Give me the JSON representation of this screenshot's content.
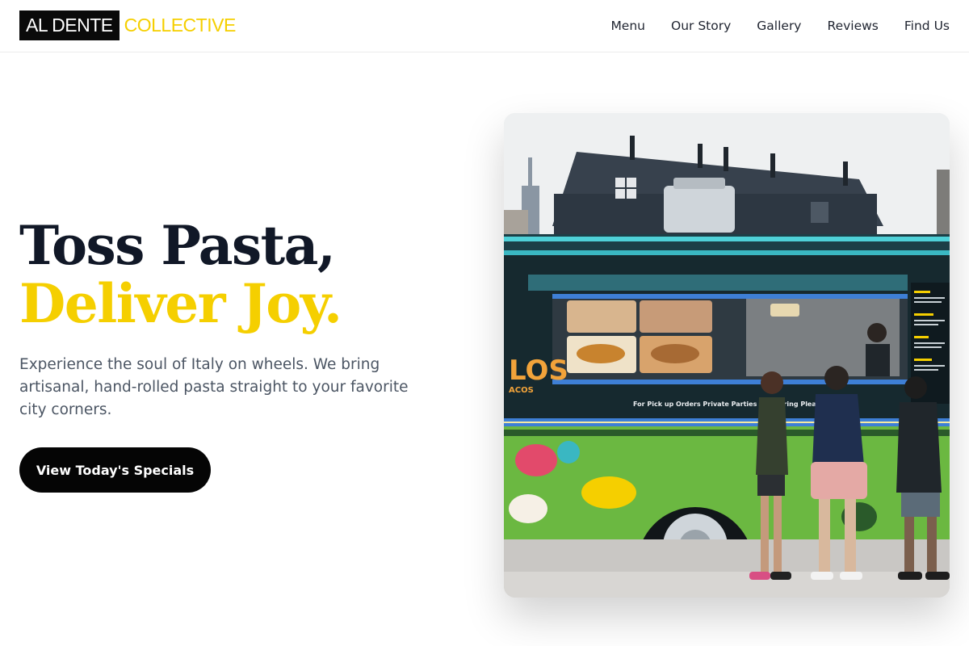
{
  "brand": {
    "part1": "AL DENTE",
    "part2": "COLLECTIVE"
  },
  "nav": {
    "items": [
      {
        "label": "Menu"
      },
      {
        "label": "Our Story"
      },
      {
        "label": "Gallery"
      },
      {
        "label": "Reviews"
      },
      {
        "label": "Find Us"
      }
    ]
  },
  "hero": {
    "title_line1": "Toss Pasta,",
    "title_line2": "Deliver Joy.",
    "subtitle": "Experience the soul of Italy on wheels. We bring artisanal, hand-rolled pasta straight to your favorite city corners.",
    "cta_label": "View Today's Specials",
    "image": {
      "alt": "food truck with customers",
      "truck_sign_text": "For Pick up Orders Private Parties & Catering Plea",
      "side_text": "LOS",
      "side_subtext": "ACOS"
    }
  },
  "colors": {
    "accent": "#f5cf00",
    "dark": "#111827",
    "button": "#050505"
  }
}
